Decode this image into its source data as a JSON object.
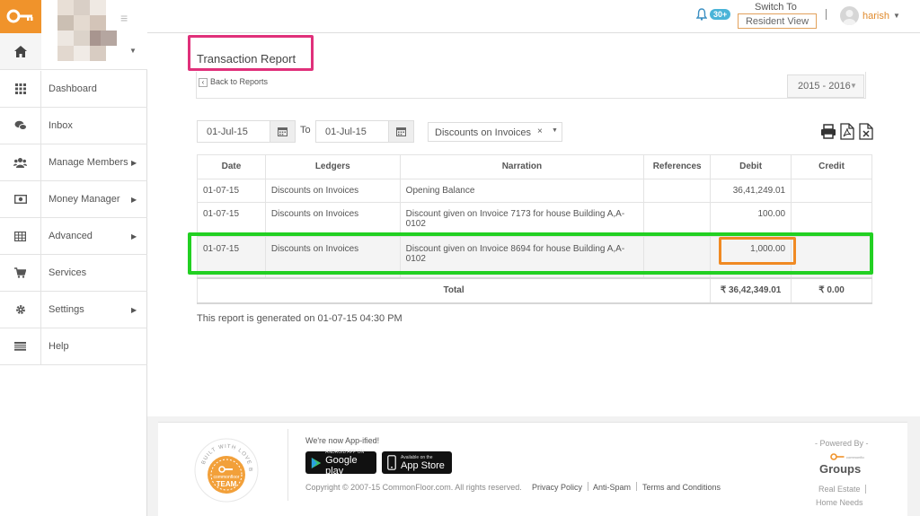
{
  "brand": {
    "accent": "#f0932b",
    "highlight_pink": "#e0307a",
    "highlight_green": "#22d022",
    "highlight_orange": "#f08a23"
  },
  "sidebar": {
    "logo_icon": "key-icon",
    "items": [
      {
        "label": "Dashboard",
        "icon": "grid-icon"
      },
      {
        "label": "Inbox",
        "icon": "chat-icon"
      },
      {
        "label": "Manage Members",
        "icon": "users-icon",
        "arrow": true
      },
      {
        "label": "Money Manager",
        "icon": "money-icon",
        "arrow": true
      },
      {
        "label": "Advanced",
        "icon": "table-icon",
        "arrow": true
      },
      {
        "label": "Services",
        "icon": "cart-icon"
      },
      {
        "label": "Settings",
        "icon": "gear-icon",
        "arrow": true
      },
      {
        "label": "Help",
        "icon": "list-icon"
      }
    ]
  },
  "topbar": {
    "notifications": "30+",
    "switch_label": "Switch To",
    "switch_button": "Resident View",
    "user": "harish"
  },
  "page": {
    "title": "Transaction Report",
    "back": "Back to Reports",
    "year": "2015 - 2016"
  },
  "filters": {
    "from": "01-Jul-15",
    "to_label": "To",
    "to": "01-Jul-15",
    "ledger": "Discounts on Invoices",
    "clear": "×"
  },
  "table": {
    "headers": [
      "Date",
      "Ledgers",
      "Narration",
      "References",
      "Debit",
      "Credit"
    ],
    "rows": [
      {
        "date": "01-07-15",
        "ledger": "Discounts on Invoices",
        "narration": "Opening Balance",
        "ref": "",
        "debit": "36,41,249.01",
        "credit": ""
      },
      {
        "date": "01-07-15",
        "ledger": "Discounts on Invoices",
        "narration": "Discount given on Invoice 7173 for house Building A,A-0102",
        "ref": "",
        "debit": "100.00",
        "credit": ""
      },
      {
        "date": "01-07-15",
        "ledger": "Discounts on Invoices",
        "narration": "Discount given on Invoice 8694 for house Building A,A-0102",
        "ref": "",
        "debit": "1,000.00",
        "credit": ""
      }
    ],
    "total_label": "Total",
    "total_debit": "₹ 36,42,349.01",
    "total_credit": "₹ 0.00"
  },
  "generated": "This report is generated on 01-07-15 04:30 PM",
  "footer": {
    "badge_top": "BUILT WITH LOVE BY",
    "badge_brand": "commonfloor",
    "badge_team": "TEAM",
    "appified": "We're now App-ified!",
    "gplay_small": "ANDROID APP ON",
    "gplay": "Google play",
    "appstore_small": "Available on the",
    "appstore": "App Store",
    "copyright": "Copyright © 2007-15 CommonFloor.com. All rights reserved.",
    "links": [
      "Privacy Policy",
      "Anti-Spam",
      "Terms and Conditions"
    ],
    "powered": "- Powered By -",
    "groups": "Groups",
    "groups_small": "commonfloor",
    "real_estate": "Real Estate",
    "home_needs": "Home Needs"
  }
}
